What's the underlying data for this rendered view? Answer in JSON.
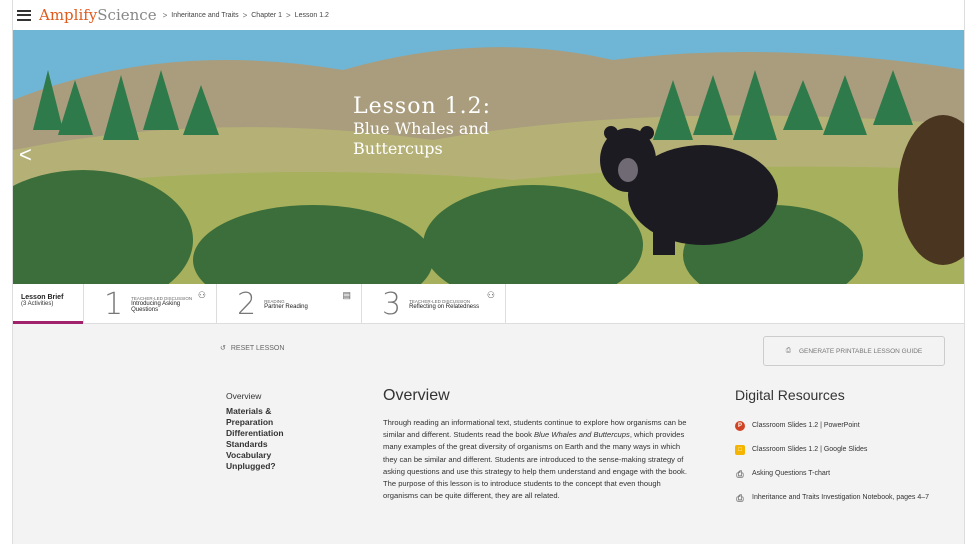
{
  "app": {
    "logo_bold": "Amplify",
    "logo_light": "Science"
  },
  "breadcrumb": {
    "items": [
      "Inheritance and Traits",
      "Chapter 1",
      "Lesson 1.2"
    ],
    "separator": ">"
  },
  "hero": {
    "title": "Lesson 1.2:",
    "subtitle_line1": "Blue Whales and",
    "subtitle_line2": "Buttercups",
    "prev_glyph": "<"
  },
  "tabs": {
    "brief": {
      "label": "Lesson Brief",
      "sub": "(3 Activities)"
    },
    "activities": [
      {
        "number": "1",
        "kind": "TEACHER-LED DISCUSSION",
        "name_line1": "Introducing Asking",
        "name_line2": "Questions",
        "icon": "discussion-icon"
      },
      {
        "number": "2",
        "kind": "READING",
        "name_line1": "Partner Reading",
        "name_line2": "",
        "icon": "book-icon"
      },
      {
        "number": "3",
        "kind": "TEACHER-LED DISCUSSION",
        "name_line1": "Reflecting on Relatedness",
        "name_line2": "",
        "icon": "discussion-icon"
      }
    ]
  },
  "actions": {
    "reset_label": "RESET LESSON",
    "generate_label": "GENERATE PRINTABLE LESSON GUIDE"
  },
  "side_nav": {
    "items": [
      "Overview",
      "Materials &",
      "Preparation",
      "Differentiation",
      "Standards",
      "Vocabulary",
      "Unplugged?"
    ]
  },
  "overview": {
    "heading": "Overview",
    "p1": "Through reading an informational text, students continue to explore how organisms can be similar and different. Students read the book ",
    "book_title": "Blue Whales and Buttercups",
    "p2": ", which provides many examples of the great diversity of organisms on Earth and the many ways in which they can be similar and different. Students are introduced to the sense-making strategy of asking questions and use this strategy to help them understand and engage with the book. The purpose of this lesson is to introduce students to the concept that even though organisms can be quite different, they are all related."
  },
  "resources": {
    "heading": "Digital Resources",
    "items": [
      {
        "label": "Classroom Slides 1.2 | PowerPoint",
        "icon": "powerpoint-icon"
      },
      {
        "label": "Classroom Slides 1.2 | Google Slides",
        "icon": "google-slides-icon"
      },
      {
        "label": "Asking Questions T-chart",
        "icon": "print-icon"
      },
      {
        "label": "Inheritance and Traits Investigation Notebook, pages 4–7",
        "icon": "print-icon"
      }
    ]
  },
  "colors": {
    "accent": "#a0226b",
    "logo": "#e05a1c",
    "powerpoint": "#d04423",
    "google_slides": "#f4b400"
  }
}
